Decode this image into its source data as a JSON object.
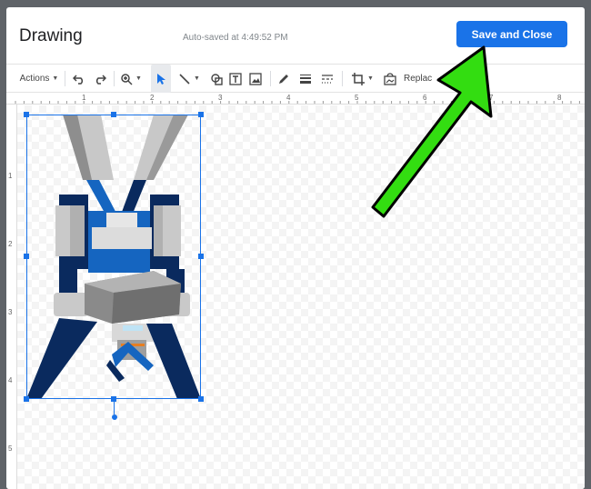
{
  "dialog": {
    "title": "Drawing",
    "autosave_text": "Auto-saved at 4:49:52 PM",
    "save_button_label": "Save and Close"
  },
  "toolbar": {
    "actions_label": "Actions",
    "replace_label": "Replac",
    "items": [
      "undo-icon",
      "redo-icon",
      "zoom-icon",
      "select-icon",
      "line-icon",
      "shape-icon",
      "text-box-icon",
      "image-icon",
      "pen-icon",
      "line-weight-icon",
      "line-dash-icon",
      "crop-icon",
      "reset-image-icon"
    ]
  },
  "ruler": {
    "horizontal_numbers": [
      "1",
      "2",
      "3",
      "4",
      "5",
      "6",
      "7",
      "8"
    ],
    "vertical_numbers": [
      "1",
      "2",
      "3",
      "4",
      "5"
    ]
  },
  "colors": {
    "accent": "#1a73e8",
    "arrow_fill": "#33dd11",
    "robot_dark_blue": "#0a2a5e",
    "robot_blue": "#1565c0",
    "robot_gray": "#c9c9c9"
  }
}
